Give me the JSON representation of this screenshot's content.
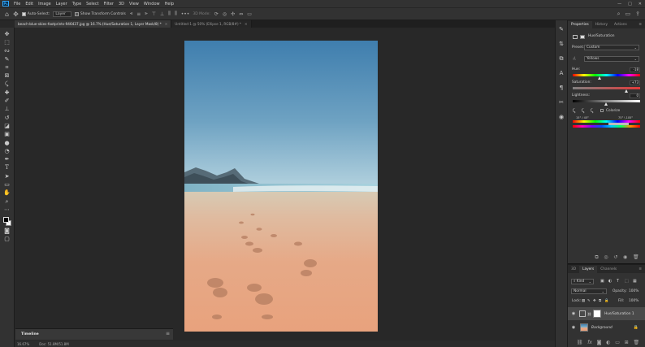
{
  "app": {
    "logo_text": "Ps",
    "menus": [
      "File",
      "Edit",
      "Image",
      "Layer",
      "Type",
      "Select",
      "Filter",
      "3D",
      "View",
      "Window",
      "Help"
    ],
    "window_controls": [
      "—",
      "□",
      "✕"
    ]
  },
  "options_bar": {
    "auto_select_label": "Auto-Select:",
    "auto_select_value": "Layer",
    "show_transform_label": "Show Transform Controls",
    "mode_3d_label": "3D Mode:",
    "more": "•••"
  },
  "tabs": [
    {
      "label": "beach-blue-skies-footprints-946437.jpg @ 16.7% (Hue/Saturation 1, Layer Mask/8) *",
      "active": true
    },
    {
      "label": "Untitled-1 @ 50% (Ellipse 1, RGB/8#) *",
      "active": false
    }
  ],
  "timeline": {
    "title": "Timeline"
  },
  "status": {
    "zoom": "16.67%",
    "doc": "Doc: 51.8M/51.8M"
  },
  "properties": {
    "tabs": [
      "Properties",
      "History",
      "Actions"
    ],
    "panel_title": "Hue/Saturation",
    "preset_label": "Preset:",
    "preset_value": "Custom",
    "channel_value": "Yellows",
    "hue_label": "Hue:",
    "hue_value": "-18",
    "saturation_label": "Saturation:",
    "saturation_value": "+73",
    "lightness_label": "Lightness:",
    "lightness_value": "0",
    "colorize_label": "Colorize",
    "range_left": "15° / 45°",
    "range_right": "75° \\ 105°"
  },
  "layers": {
    "tabs": [
      "3D",
      "Layers",
      "Channels"
    ],
    "kind_label": "Kind",
    "blend_mode": "Normal",
    "opacity_label": "Opacity:",
    "opacity_value": "100%",
    "lock_label": "Lock:",
    "fill_label": "Fill:",
    "fill_value": "100%",
    "items": [
      {
        "name": "Hue/Saturation 1",
        "selected": true
      },
      {
        "name": "Background",
        "selected": false
      }
    ]
  }
}
